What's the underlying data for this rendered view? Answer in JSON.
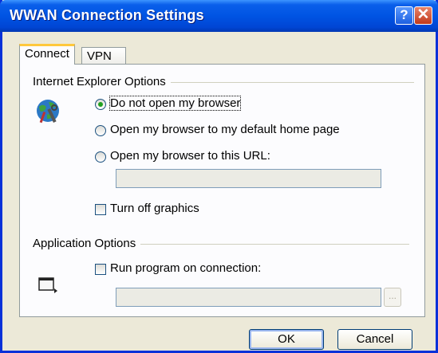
{
  "window": {
    "title": "WWAN Connection Settings"
  },
  "titlebar_buttons": {
    "help": "?",
    "close": "✕"
  },
  "tabs": [
    {
      "label": "Connect",
      "active": true
    },
    {
      "label": "VPN",
      "active": false
    }
  ],
  "ie_options": {
    "group_label": "Internet Explorer Options",
    "radios": [
      {
        "label": "Do not open my browser",
        "selected": true
      },
      {
        "label": "Open my browser to my default home page",
        "selected": false
      },
      {
        "label": "Open my browser to this URL:",
        "selected": false
      }
    ],
    "url_value": "",
    "turn_off_graphics": {
      "label": "Turn off graphics",
      "checked": false
    }
  },
  "app_options": {
    "group_label": "Application Options",
    "run_program": {
      "label": "Run program on connection:",
      "checked": false
    },
    "program_path": "",
    "browse_label": "..."
  },
  "buttons": {
    "ok": "OK",
    "cancel": "Cancel"
  },
  "icons": {
    "ie": "globe-tools-icon",
    "program": "window-icon"
  }
}
